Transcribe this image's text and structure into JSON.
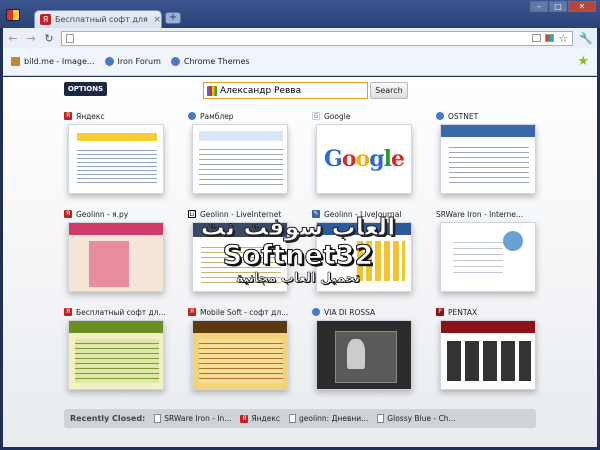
{
  "tab": {
    "title": "Бесплатный софт для ва...",
    "favicon": "yandex-favicon",
    "close": "×"
  },
  "newtab_label": "+",
  "window_controls": {
    "minimize": "–",
    "maximize": "□",
    "close": "✕"
  },
  "toolbar": {
    "back": "←",
    "forward": "→",
    "reload": "↻",
    "url_value": "",
    "star": "☆",
    "wrench": "🔧"
  },
  "bookmarks": [
    {
      "label": "bild.me - Image...",
      "icon": "page-icon"
    },
    {
      "label": "Iron Forum",
      "icon": "globe-icon"
    },
    {
      "label": "Chrome Themes",
      "icon": "globe-icon"
    }
  ],
  "bookmark_star": "★",
  "options_label": "OPTIONS",
  "search": {
    "value": "Александр Ревва",
    "button": "Search"
  },
  "tiles": [
    {
      "title": "Яндекс",
      "icon": "Я",
      "thumb": "yandex"
    },
    {
      "title": "Рамблер",
      "icon": "globe",
      "thumb": "rambler"
    },
    {
      "title": "Google",
      "icon": "G",
      "thumb": "google"
    },
    {
      "title": "OSTNET",
      "icon": "globe",
      "thumb": "ostnet"
    },
    {
      "title": "Geolinn - я.ру",
      "icon": "Я",
      "thumb": "geo1"
    },
    {
      "title": "Geolinn - LiveInternet",
      "icon": "Li",
      "thumb": "geo2"
    },
    {
      "title": "Geolinn - LiveJournal",
      "icon": "pen",
      "thumb": "geo3"
    },
    {
      "title": "SRWare Iron - Interne...",
      "icon": "page",
      "thumb": "srware"
    },
    {
      "title": "Бесплатный софт дл...",
      "icon": "Я",
      "thumb": "free1"
    },
    {
      "title": "Mobile Soft - софт дл...",
      "icon": "Я",
      "thumb": "mobile"
    },
    {
      "title": "VIA DI ROSSA",
      "icon": "globe",
      "thumb": "via"
    },
    {
      "title": "PENTAX",
      "icon": "P",
      "thumb": "pentax"
    }
  ],
  "google_logo": [
    "G",
    "o",
    "o",
    "g",
    "l",
    "e"
  ],
  "watermark": {
    "arabic": "العاب سوفت نت",
    "english": "Softnet32",
    "subtitle": "تحميل العاب مجانية"
  },
  "recently_closed": {
    "label": "Recently Closed:",
    "items": [
      {
        "label": "SRWare Iron - In...",
        "icon": "page"
      },
      {
        "label": "Яндекс",
        "icon": "Я"
      },
      {
        "label": "geolinn: Дневни...",
        "icon": "page"
      },
      {
        "label": "Glossy Blue - Ch...",
        "icon": "page"
      }
    ]
  }
}
